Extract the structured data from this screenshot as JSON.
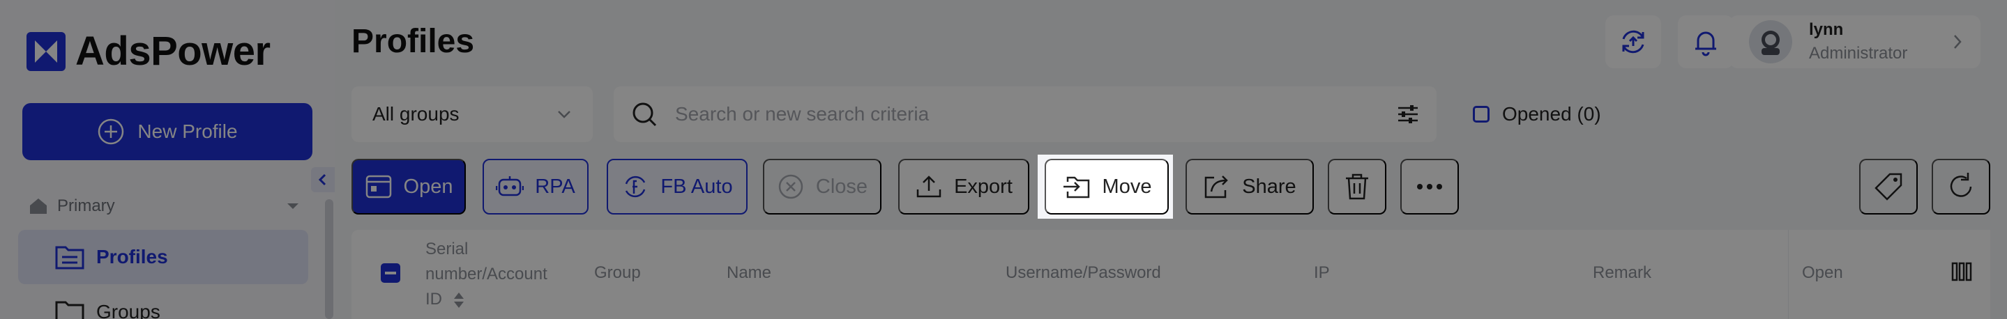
{
  "brand": {
    "name": "AdsPower"
  },
  "sidebar": {
    "new_profile_label": "New Profile",
    "section_label": "Primary",
    "items": [
      {
        "label": "Profiles",
        "active": true
      },
      {
        "label": "Groups",
        "active": false
      }
    ]
  },
  "header": {
    "title": "Profiles",
    "user": {
      "name": "lynn",
      "role": "Administrator"
    }
  },
  "filters": {
    "group_select": "All groups",
    "search_placeholder": "Search or new search criteria",
    "opened_label": "Opened (0)"
  },
  "toolbar": {
    "open": "Open",
    "rpa": "RPA",
    "fb_auto": "FB Auto",
    "close": "Close",
    "export": "Export",
    "move": "Move",
    "share": "Share"
  },
  "table": {
    "columns": {
      "serial": "Serial number/Account ID",
      "group": "Group",
      "name": "Name",
      "username": "Username/Password",
      "ip": "IP",
      "remark": "Remark",
      "open": "Open"
    }
  },
  "colors": {
    "accent": "#1f30d6",
    "overlay": "rgba(0,0,0,0.48)"
  }
}
